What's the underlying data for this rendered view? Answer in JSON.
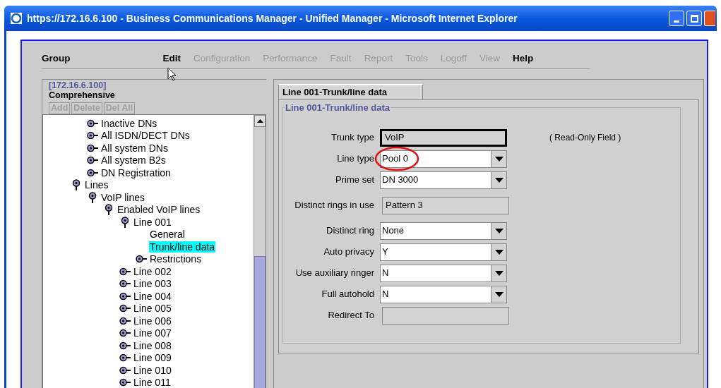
{
  "window": {
    "title": "https://172.16.6.100 - Business Communications Manager - Unified Manager - Microsoft Internet Explorer"
  },
  "menu": [
    {
      "label": "Group",
      "disabled": false
    },
    {
      "label": "Edit",
      "disabled": false
    },
    {
      "label": "Configuration",
      "disabled": true
    },
    {
      "label": "Performance",
      "disabled": true
    },
    {
      "label": "Fault",
      "disabled": true
    },
    {
      "label": "Report",
      "disabled": true
    },
    {
      "label": "Tools",
      "disabled": true
    },
    {
      "label": "Logoff",
      "disabled": true
    },
    {
      "label": "View",
      "disabled": true
    },
    {
      "label": "Help",
      "disabled": false
    }
  ],
  "sidebar": {
    "address": "[172.16.6.100]",
    "view": "Comprehensive",
    "buttons": [
      {
        "label": "Add",
        "disabled": true
      },
      {
        "label": "Delete",
        "disabled": true
      },
      {
        "label": "Del All",
        "disabled": true
      }
    ],
    "continued_items": [
      {
        "label": "Inactive DNs",
        "expanded": false,
        "selected": false
      },
      {
        "label": "All ISDN/DECT DNs",
        "expanded": false,
        "selected": false
      },
      {
        "label": "All system DNs",
        "expanded": false,
        "selected": false
      },
      {
        "label": "All system B2s",
        "expanded": false,
        "selected": false
      },
      {
        "label": "DN Registration",
        "expanded": false,
        "selected": false
      }
    ],
    "items": [
      {
        "label": "Lines",
        "expanded": true,
        "selected": false,
        "children": [
          {
            "label": "VoIP lines",
            "expanded": true,
            "selected": false,
            "children": [
              {
                "label": "Enabled VoIP lines",
                "expanded": true,
                "selected": false,
                "children": [
                  {
                    "label": "Line 001",
                    "expanded": true,
                    "selected": false,
                    "children": [
                      {
                        "label": "General",
                        "selected": false
                      },
                      {
                        "label": "Trunk/line data",
                        "selected": true
                      },
                      {
                        "label": "Restrictions",
                        "expanded": false,
                        "selected": false
                      }
                    ]
                  },
                  {
                    "label": "Line 002",
                    "expanded": false,
                    "selected": false
                  },
                  {
                    "label": "Line 003",
                    "expanded": false,
                    "selected": false
                  },
                  {
                    "label": "Line 004",
                    "expanded": false,
                    "selected": false
                  },
                  {
                    "label": "Line 005",
                    "expanded": false,
                    "selected": false
                  },
                  {
                    "label": "Line 006",
                    "expanded": false,
                    "selected": false
                  },
                  {
                    "label": "Line 007",
                    "expanded": false,
                    "selected": false
                  },
                  {
                    "label": "Line 008",
                    "expanded": false,
                    "selected": false
                  },
                  {
                    "label": "Line 009",
                    "expanded": false,
                    "selected": false
                  },
                  {
                    "label": "Line 010",
                    "expanded": false,
                    "selected": false
                  },
                  {
                    "label": "Line 011",
                    "expanded": false,
                    "selected": false
                  }
                ]
              }
            ]
          }
        ]
      }
    ]
  },
  "tabs": [
    {
      "label": "Line 001-Trunk/line data",
      "selected": true
    }
  ],
  "form": {
    "legend": "Line 001-Trunk/line data",
    "fields": [
      {
        "label": "Trunk type",
        "kind": "readonly",
        "value": "VoIP",
        "focused": true,
        "note": "( Read-Only Field )"
      },
      {
        "label": "Line type",
        "kind": "select",
        "value": "Pool 0",
        "circled": true
      },
      {
        "label": "Prime set",
        "kind": "select",
        "value": "DN 3000"
      },
      {
        "label": "Distinct rings in use",
        "kind": "readonly",
        "value": "Pattern 3"
      },
      {
        "label": "Distinct ring",
        "kind": "select",
        "value": "None"
      },
      {
        "label": "Auto privacy",
        "kind": "select",
        "value": "Y"
      },
      {
        "label": "Use auxiliary ringer",
        "kind": "select",
        "value": "N"
      },
      {
        "label": "Full autohold",
        "kind": "select",
        "value": "N"
      },
      {
        "label": "Redirect To",
        "kind": "readonly"
      }
    ]
  }
}
